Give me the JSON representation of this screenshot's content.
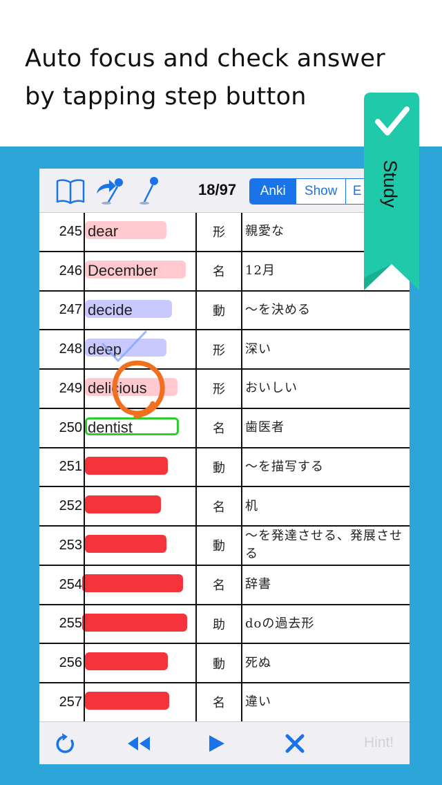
{
  "caption": {
    "line1": "Auto focus and check answer",
    "line2": "by tapping step button"
  },
  "toolbar": {
    "icons": [
      "book-icon",
      "share-pin-icon",
      "pin-icon"
    ],
    "counter": "18/97",
    "segments": [
      {
        "label": "Anki",
        "active": true
      },
      {
        "label": "Show",
        "active": false
      },
      {
        "label": "E",
        "active": false
      }
    ]
  },
  "rows": [
    {
      "num": "245",
      "word": "dear",
      "pos": "形",
      "meaning": "親愛な",
      "state": "pink"
    },
    {
      "num": "246",
      "word": "December",
      "pos": "名",
      "meaning": "12月",
      "state": "pink"
    },
    {
      "num": "247",
      "word": "decide",
      "pos": "動",
      "meaning": "～を決める",
      "state": "lavender"
    },
    {
      "num": "248",
      "word": "deep",
      "pos": "形",
      "meaning": "深い",
      "state": "lavender"
    },
    {
      "num": "249",
      "word": "delicious",
      "pos": "形",
      "meaning": "おいしい",
      "state": "pink"
    },
    {
      "num": "250",
      "word": "dentist",
      "pos": "名",
      "meaning": "歯医者",
      "state": "focused"
    },
    {
      "num": "251",
      "word": "",
      "pos": "動",
      "meaning": "～を描写する",
      "state": "hidden"
    },
    {
      "num": "252",
      "word": "",
      "pos": "名",
      "meaning": "机",
      "state": "hidden"
    },
    {
      "num": "253",
      "word": "",
      "pos": "動",
      "meaning": "～を発達させる、発展させる",
      "state": "hidden"
    },
    {
      "num": "254",
      "word": "",
      "pos": "名",
      "meaning": "辞書",
      "state": "hidden"
    },
    {
      "num": "255",
      "word": "",
      "pos": "助",
      "meaning": "doの過去形",
      "state": "hidden"
    },
    {
      "num": "256",
      "word": "",
      "pos": "動",
      "meaning": "死ぬ",
      "state": "hidden"
    },
    {
      "num": "257",
      "word": "",
      "pos": "名",
      "meaning": "違い",
      "state": "hidden"
    }
  ],
  "bottombar": {
    "icons": [
      "refresh-icon",
      "rewind-icon",
      "play-icon",
      "close-icon"
    ],
    "hint_label": "Hint!"
  },
  "ribbon": {
    "label": "Study",
    "icon": "checkmark-icon"
  },
  "colors": {
    "background_blue": "#2ea5d8",
    "ribbon_green": "#1fc9a9",
    "accent_blue": "#1a73e8",
    "pink_highlight": "#ffc9cf",
    "lavender_highlight": "#c9c9ff",
    "mask_red": "#f4333b",
    "focus_green": "#2ecc2e",
    "circle_orange": "#f07020"
  }
}
